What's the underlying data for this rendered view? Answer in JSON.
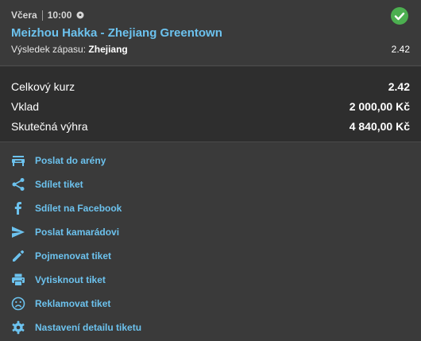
{
  "bet": {
    "day": "Včera",
    "time": "10:00",
    "sport_icon": "soccer-ball-icon",
    "status_icon": "check-circle-icon",
    "status_color": "#4caf50",
    "match": "Meizhou Hakka - Zhejiang Greentown",
    "result_label": "Výsledek zápasu:",
    "result_value": "Zhejiang",
    "odd": "2.42"
  },
  "summary": {
    "rows": [
      {
        "label": "Celkový kurz",
        "value": "2.42"
      },
      {
        "label": "Vklad",
        "value": "2 000,00 Kč"
      },
      {
        "label": "Skutečná výhra",
        "value": "4 840,00 Kč"
      }
    ]
  },
  "actions": [
    {
      "label": "Poslat do arény",
      "icon": "arena-icon"
    },
    {
      "label": "Sdílet tiket",
      "icon": "share-icon"
    },
    {
      "label": "Sdílet na Facebook",
      "icon": "facebook-icon"
    },
    {
      "label": "Poslat kamarádovi",
      "icon": "send-icon"
    },
    {
      "label": "Pojmenovat tiket",
      "icon": "pencil-icon"
    },
    {
      "label": "Vytisknout tiket",
      "icon": "printer-icon"
    },
    {
      "label": "Reklamovat tiket",
      "icon": "sad-face-icon"
    },
    {
      "label": "Nastavení detailu tiketu",
      "icon": "gear-icon"
    }
  ],
  "accent_color": "#6cc2ee"
}
